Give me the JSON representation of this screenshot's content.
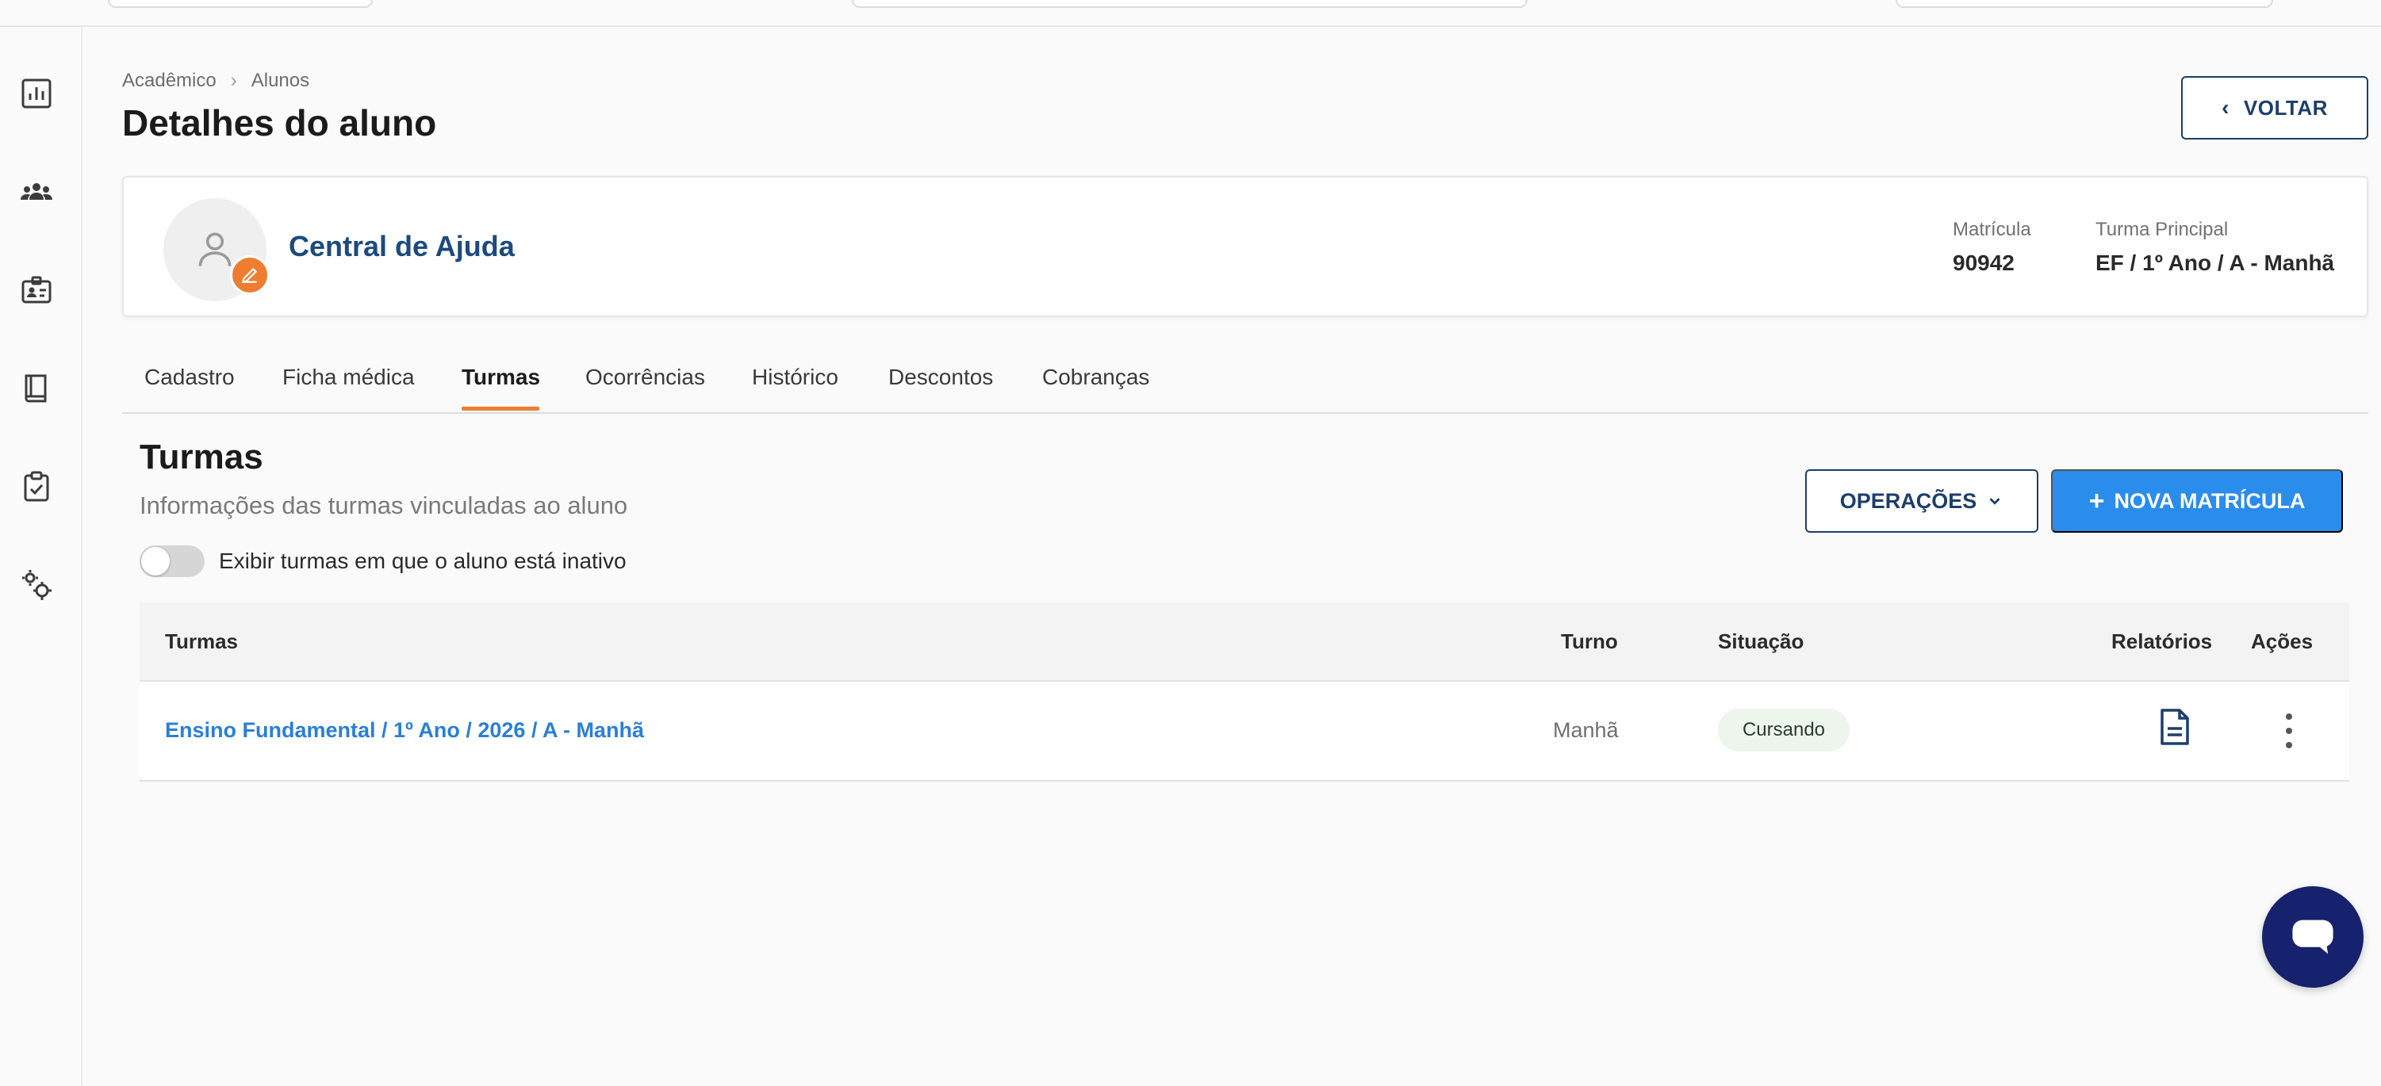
{
  "breadcrumb": {
    "items": [
      "Acadêmico",
      "Alunos"
    ],
    "separator": ">"
  },
  "page": {
    "title": "Detalhes do aluno"
  },
  "header": {
    "back_label": "VOLTAR"
  },
  "student": {
    "name": "Central de Ajuda",
    "matricula_label": "Matrícula",
    "matricula_value": "90942",
    "turma_principal_label": "Turma Principal",
    "turma_principal_value": "EF / 1º Ano / A - Manhã"
  },
  "tabs": [
    {
      "label": "Cadastro"
    },
    {
      "label": "Ficha médica"
    },
    {
      "label": "Turmas",
      "active": true
    },
    {
      "label": "Ocorrências"
    },
    {
      "label": "Histórico"
    },
    {
      "label": "Descontos"
    },
    {
      "label": "Cobranças"
    }
  ],
  "section": {
    "title": "Turmas",
    "subtitle": "Informações das turmas vinculadas ao aluno",
    "toggle_label": "Exibir turmas em que o aluno está inativo",
    "toggle_on": false,
    "operations_label": "OPERAÇÕES",
    "new_enrollment_label": "NOVA MATRÍCULA"
  },
  "table": {
    "headers": {
      "turmas": "Turmas",
      "turno": "Turno",
      "situacao": "Situação",
      "relatorios": "Relatórios",
      "acoes": "Ações"
    },
    "rows": [
      {
        "turma": "Ensino Fundamental / 1º Ano / 2026 / A - Manhã",
        "turno": "Manhã",
        "situacao": "Cursando"
      }
    ]
  },
  "sidebar": {
    "icons": [
      "chart-icon",
      "users-icon",
      "id-card-icon",
      "book-icon",
      "clipboard-check-icon",
      "settings-icon"
    ]
  },
  "colors": {
    "accent": "#ef7d30",
    "primary": "#2a8ceb",
    "navy": "#1c3e6b",
    "chat": "#16226d",
    "chip_bg": "#edf5ec"
  }
}
